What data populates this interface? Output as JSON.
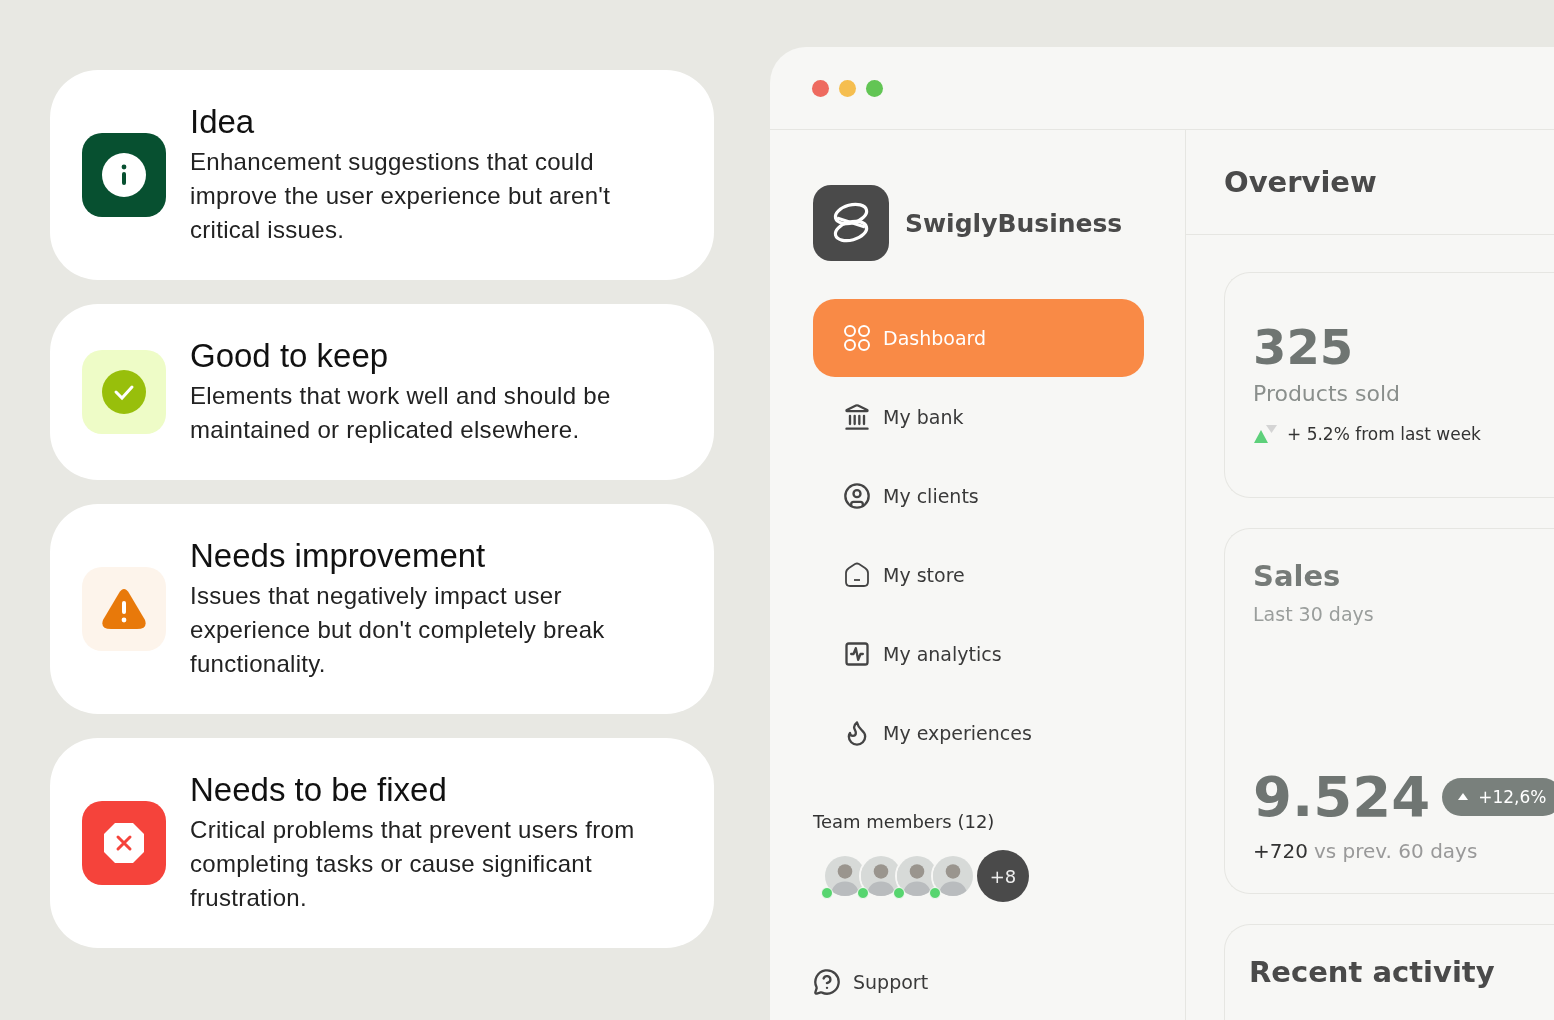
{
  "feedback_cards": [
    {
      "kind": "info",
      "title": "Idea",
      "description": "Enhancement suggestions that could improve the user experience but aren't critical issues."
    },
    {
      "kind": "success",
      "title": "Good to keep",
      "description": "Elements that work well and should be maintained or replicated elsewhere."
    },
    {
      "kind": "warning",
      "title": "Needs improvement",
      "description": "Issues that negatively impact user experience but don't completely break functionality."
    },
    {
      "kind": "error",
      "title": "Needs to be fixed",
      "description": "Critical problems that prevent users from completing tasks or cause significant frustration."
    }
  ],
  "window": {
    "brand": "SwiglyBusiness",
    "page_title": "Overview"
  },
  "sidebar": {
    "items": [
      {
        "kind": "dashboard",
        "label": "Dashboard",
        "selected": true
      },
      {
        "kind": "bank",
        "label": "My bank",
        "selected": false
      },
      {
        "kind": "clients",
        "label": "My clients",
        "selected": false
      },
      {
        "kind": "store",
        "label": "My store",
        "selected": false
      },
      {
        "kind": "analytics",
        "label": "My analytics",
        "selected": false
      },
      {
        "kind": "experiences",
        "label": "My experiences",
        "selected": false
      }
    ],
    "team": {
      "heading": "Team members (12)",
      "members": [
        {
          "online": true
        },
        {
          "online": true
        },
        {
          "online": true
        },
        {
          "online": true
        }
      ],
      "more": "+8"
    },
    "support": "Support"
  },
  "stats": {
    "value": "325",
    "label": "Products sold",
    "trend": "+ 5.2% from last week"
  },
  "sales": {
    "title": "Sales",
    "period": "Last 30 days",
    "value": "9.524",
    "badge": "+12,6%",
    "delta": "+720",
    "comparison": "vs prev. 60 days"
  },
  "recent_activity": {
    "title": "Recent activity"
  }
}
